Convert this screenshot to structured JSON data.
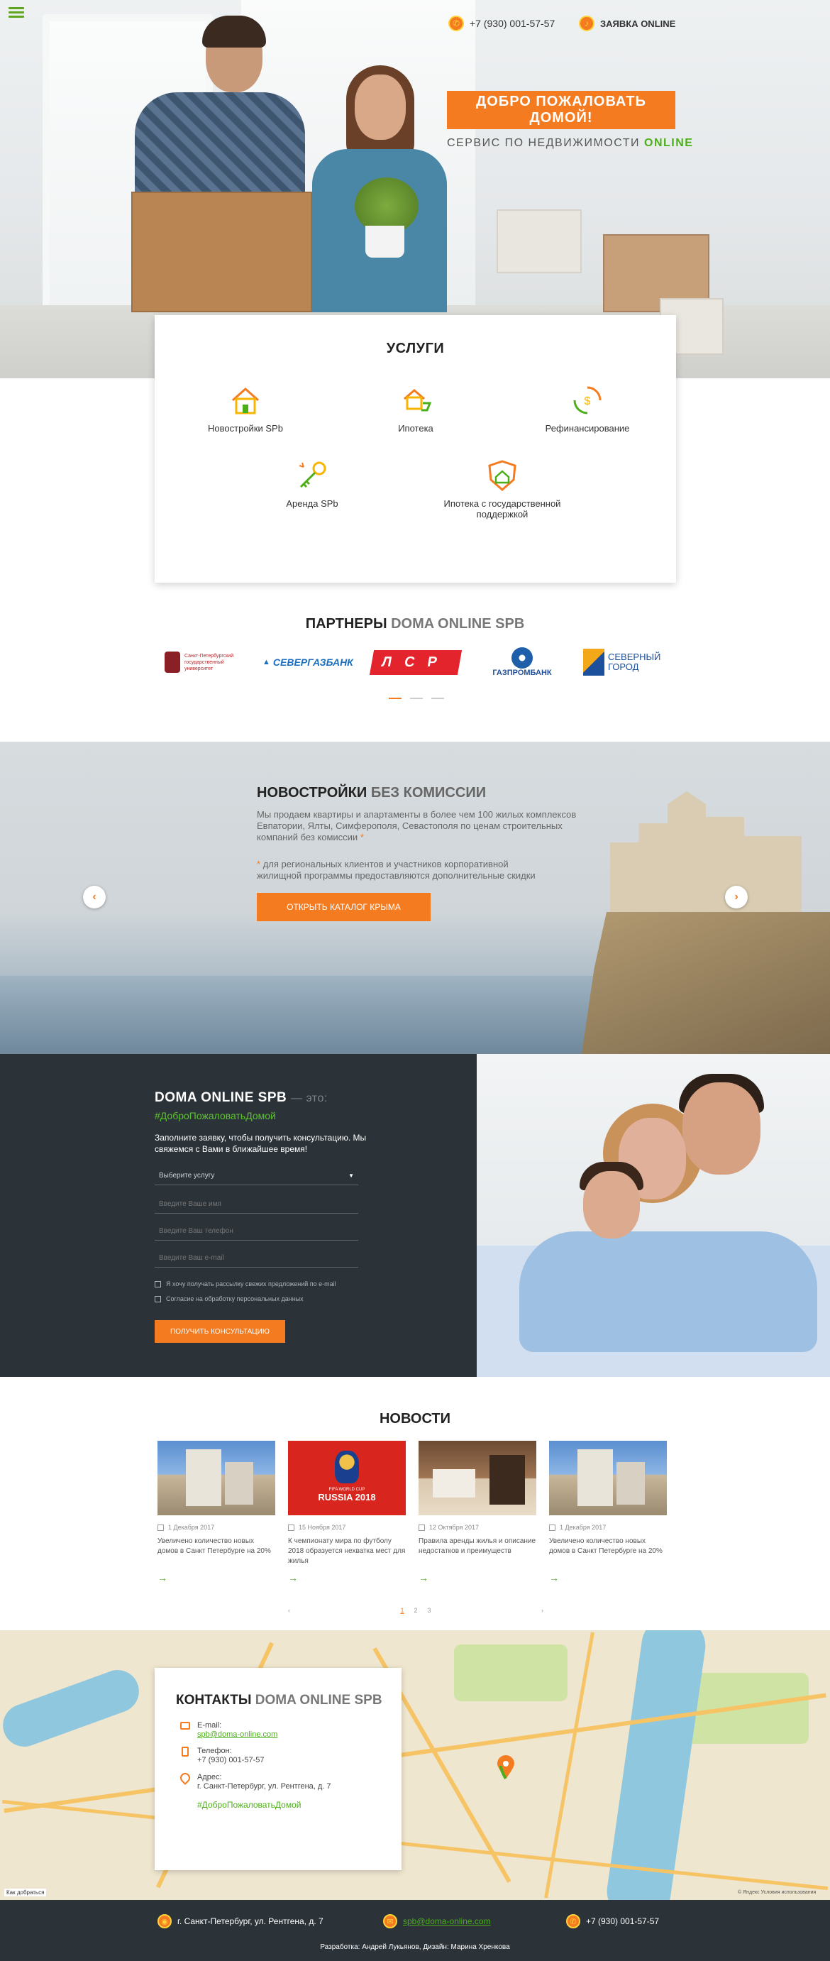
{
  "header": {
    "phone": "+7 (930) 001-57-57",
    "request": "ЗАЯВКА ONLINE",
    "welcome": "ДОБРО ПОЖАЛОВАТЬ ДОМОЙ!",
    "tagline_prefix": "СЕРВИС ПО НЕДВИЖИМОСТИ",
    "tagline_accent": "ONLINE"
  },
  "services": {
    "title": "УСЛУГИ",
    "items": [
      {
        "label": "Новостройки SPb"
      },
      {
        "label": "Ипотека"
      },
      {
        "label": "Рефинансирование"
      },
      {
        "label": "Аренда SPb"
      },
      {
        "label": "Ипотека с государственной поддержкой"
      }
    ]
  },
  "partners": {
    "title_main": "ПАРТНЕРЫ",
    "title_muted": "DOMA ONLINE SPB",
    "logos": [
      "Санкт-Петербургский государственный университет",
      "СЕВЕРГАЗБАНК",
      "ЛСР",
      "ГАЗПРОМБАНК",
      "СЕВЕРНЫЙ ГОРОД"
    ]
  },
  "crimea": {
    "title_main": "НОВОСТРОЙКИ",
    "title_muted": "БЕЗ КОМИССИИ",
    "text": "Мы продаем квартиры и апартаменты в более чем 100 жилых комплексов Евпатории, Ялты, Симферополя, Севастополя по ценам строительных компаний без комиссии",
    "star": "*",
    "note": "для региональных клиентов и участников корпоративной жилищной программы предоставляются дополнительные скидки",
    "button": "ОТКРЫТЬ КАТАЛОГ КРЫМА",
    "prev": "‹",
    "next": "›"
  },
  "form": {
    "title_main": "DOMA ONLINE SPB",
    "title_muted": "— это:",
    "hashtag": "#ДоброПожаловатьДомой",
    "intro": "Заполните заявку, чтобы получить консультацию. Мы свяжемся с Вами в ближайшее время!",
    "select_placeholder": "Выберите услугу",
    "name_placeholder": "Введите Ваше имя",
    "phone_placeholder": "Введите Ваш телефон",
    "email_placeholder": "Введите Ваш e-mail",
    "check1": "Я хочу получать рассылку свежих предложений по e-mail",
    "check2": "Согласие на обработку персональных данных",
    "button": "ПОЛУЧИТЬ КОНСУЛЬТАЦИЮ"
  },
  "news": {
    "title": "НОВОСТИ",
    "items": [
      {
        "date": "1 Декабря 2017",
        "text": "Увеличено количество новых домов в Санкт Петербурге на 20%"
      },
      {
        "date": "15 Ноября 2017",
        "text": "К чемпионату мира по футболу 2018 образуется нехватка мест для жилья",
        "img_text": "RUSSIA 2018",
        "img_sub": "FIFA WORLD CUP"
      },
      {
        "date": "12 Октября 2017",
        "text": "Правила аренды жилья и описание недостатков и преимуществ"
      },
      {
        "date": "1 Декабря 2017",
        "text": "Увеличено количество новых домов в Санкт Петербурге на 20%"
      }
    ],
    "pager": {
      "prev": "‹",
      "p1": "1",
      "p2": "2",
      "p3": "3",
      "next": "›"
    },
    "arrow": "→"
  },
  "contacts": {
    "title_main": "КОНТАКТЫ",
    "title_muted": "DOMA ONLINE SPB",
    "email_label": "E-mail:",
    "email": "spb@doma-online.com",
    "phone_label": "Телефон:",
    "phone": "+7 (930) 001-57-57",
    "address_label": "Адрес:",
    "address": "г. Санкт-Петербург, ул. Рентгена, д. 7",
    "hashtag": "#ДоброПожаловатьДомой",
    "map_link": "Как добраться",
    "map_copy": "© Яндекс Условия использования"
  },
  "footer": {
    "address": "г. Санкт-Петербург, ул. Рентгена, д. 7",
    "email": "spb@doma-online.com",
    "phone": "+7 (930) 001-57-57",
    "credit": "Разработка: Андрей Лукьянов, Дизайн: Марина Хренкова"
  },
  "colors": {
    "accent": "#f47b20",
    "green": "#4caf1a",
    "dark": "#2b3339"
  }
}
